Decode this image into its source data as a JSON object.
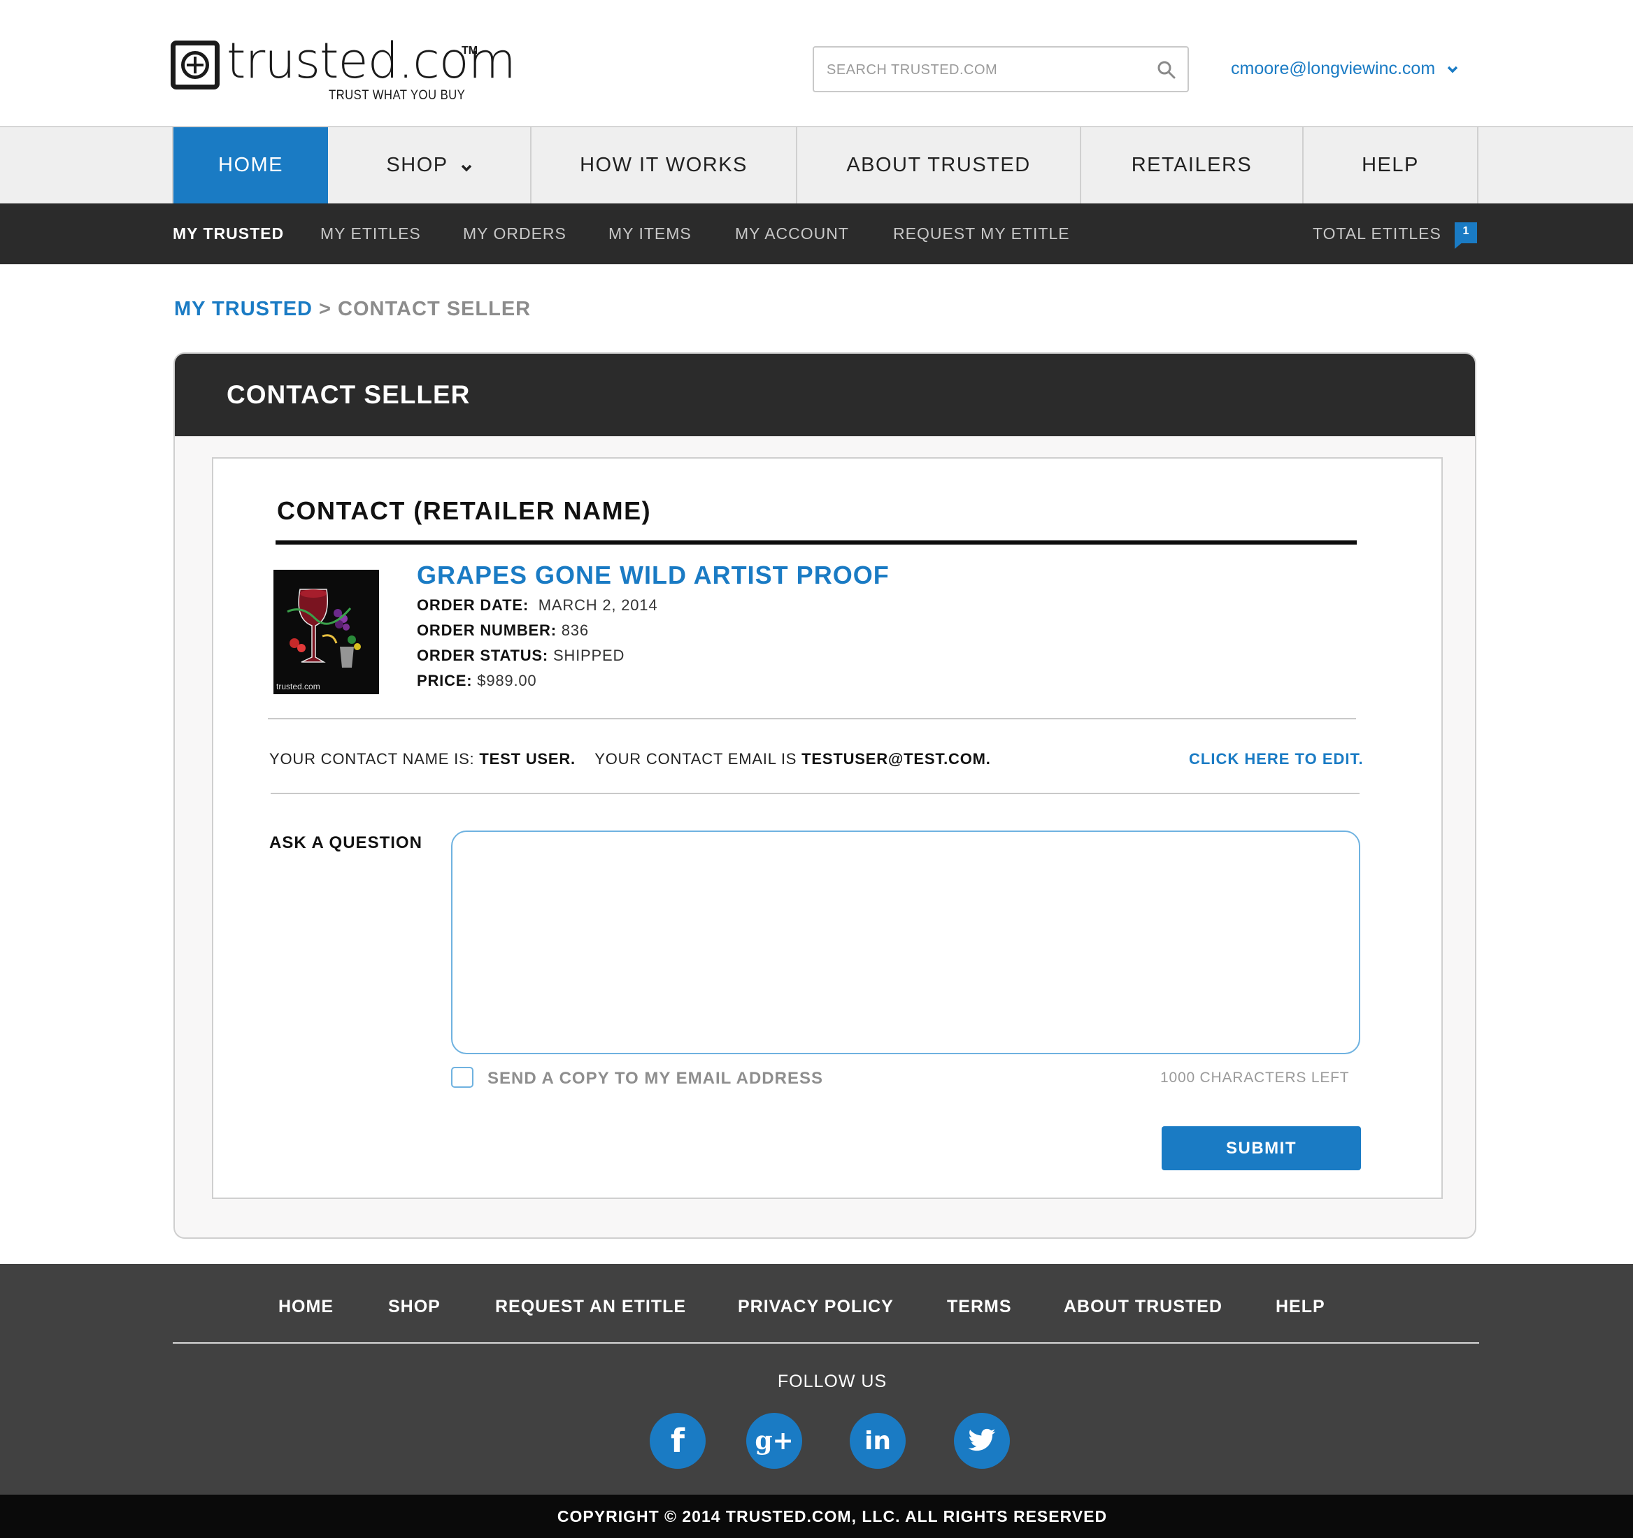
{
  "brand": {
    "wordmark": "trusted.com",
    "trademark": "TM",
    "tagline": "TRUST WHAT YOU BUY"
  },
  "search": {
    "placeholder": "SEARCH TRUSTED.COM",
    "icon": "search-icon"
  },
  "user": {
    "email": "cmoore@longviewinc.com"
  },
  "main_nav": {
    "items": [
      {
        "label": "HOME",
        "active": true
      },
      {
        "label": "SHOP",
        "has_dropdown": true
      },
      {
        "label": "HOW IT WORKS"
      },
      {
        "label": "ABOUT TRUSTED"
      },
      {
        "label": "RETAILERS"
      },
      {
        "label": "HELP"
      }
    ]
  },
  "sub_nav": {
    "items": [
      {
        "label": "MY TRUSTED",
        "active": true
      },
      {
        "label": "MY ETITLES"
      },
      {
        "label": "MY ORDERS"
      },
      {
        "label": "MY ITEMS"
      },
      {
        "label": "MY ACCOUNT"
      },
      {
        "label": "REQUEST MY ETITLE"
      }
    ],
    "total_label": "TOTAL ETITLES",
    "total_count": "1"
  },
  "breadcrumb": {
    "parent": "MY TRUSTED",
    "separator": ">",
    "current": "CONTACT SELLER"
  },
  "panel": {
    "title": "CONTACT SELLER"
  },
  "contact": {
    "title": "CONTACT (RETAILER NAME)",
    "item": {
      "name": "GRAPES GONE WILD ARTIST PROOF",
      "image_caption": "trusted.com",
      "order_date_label": "ORDER DATE:",
      "order_date": "MARCH 2, 2014",
      "order_number_label": "ORDER NUMBER:",
      "order_number": "836",
      "order_status_label": "ORDER STATUS:",
      "order_status": "SHIPPED",
      "price_label": "PRICE:",
      "price": "$989.00"
    },
    "name_prefix": "YOUR CONTACT NAME IS:",
    "name_value": "TEST USER.",
    "email_prefix": "YOUR CONTACT EMAIL IS",
    "email_value": "TESTUSER@TEST.COM.",
    "edit_link": "CLICK HERE TO EDIT.",
    "ask_label": "ASK A QUESTION",
    "question_value": "",
    "copy_label": "SEND A COPY TO MY EMAIL ADDRESS",
    "copy_checked": false,
    "chars_left": "1000 CHARACTERS LEFT",
    "submit_label": "SUBMIT"
  },
  "footer": {
    "nav": [
      "HOME",
      "SHOP",
      "REQUEST AN ETITLE",
      "PRIVACY POLICY",
      "TERMS",
      "ABOUT TRUSTED",
      "HELP"
    ],
    "follow_label": "FOLLOW US",
    "social": [
      {
        "name": "facebook-icon",
        "glyph": "f"
      },
      {
        "name": "google-plus-icon",
        "glyph": "g+"
      },
      {
        "name": "linkedin-icon",
        "glyph": "in"
      },
      {
        "name": "twitter-icon",
        "glyph": "t"
      }
    ],
    "copyright": "COPYRIGHT © 2014 TRUSTED.COM, LLC. ALL RIGHTS RESERVED"
  },
  "colors": {
    "accent": "#1a7bc4",
    "dark_bar": "#2b2b2b",
    "footer_bg": "#414141",
    "nav_bg": "#efefef"
  }
}
